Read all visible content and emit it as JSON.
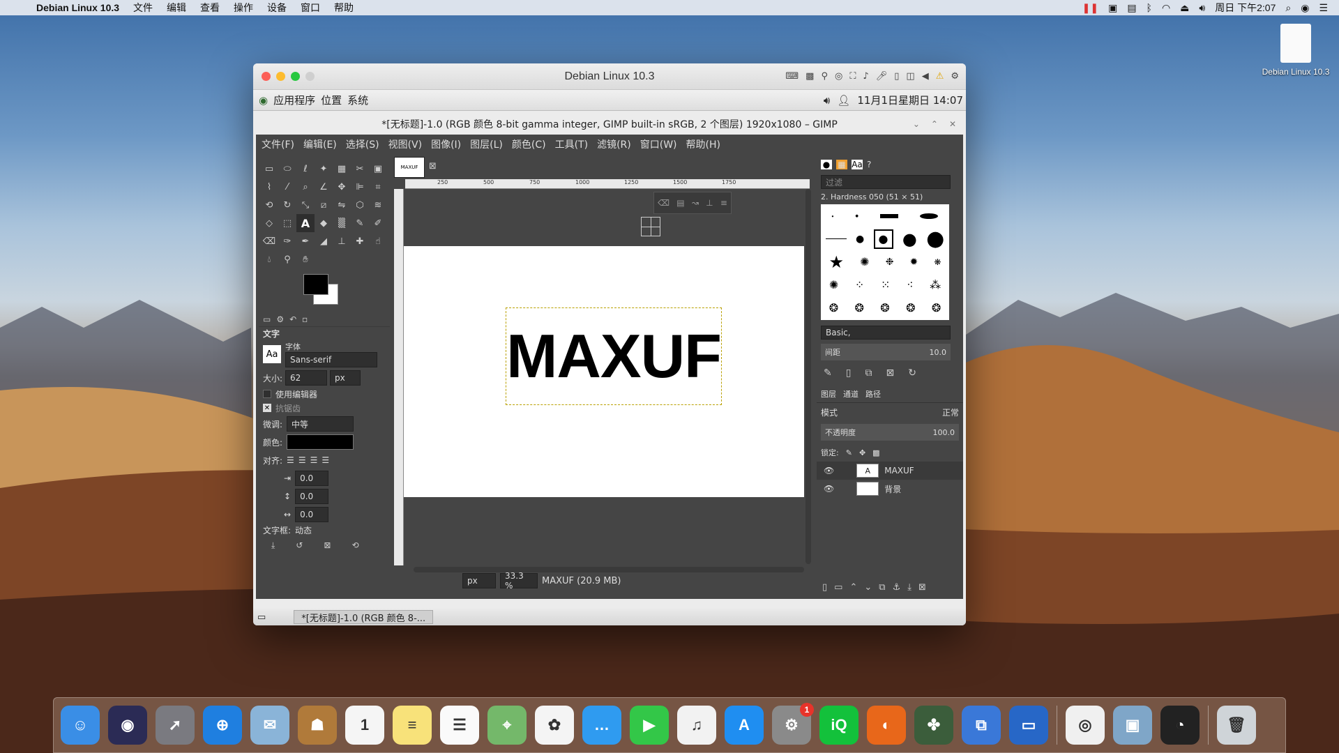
{
  "menubar": {
    "app": "Debian Linux 10.3",
    "items": [
      "文件",
      "编辑",
      "查看",
      "操作",
      "设备",
      "窗口",
      "帮助"
    ],
    "clock": "周日 下午2:07"
  },
  "desktop": {
    "file_label": "Debian Linux 10.3"
  },
  "vm": {
    "title": "Debian Linux 10.3",
    "panel_items": [
      "应用程序",
      "位置",
      "系统"
    ],
    "panel_clock": "11月1日星期日 14:07"
  },
  "gimp": {
    "title": "*[无标题]-1.0 (RGB 颜色 8-bit gamma integer, GIMP built-in sRGB, 2 个图层) 1920x1080 – GIMP",
    "menu": [
      "文件(F)",
      "编辑(E)",
      "选择(S)",
      "视图(V)",
      "图像(I)",
      "图层(L)",
      "颜色(C)",
      "工具(T)",
      "滤镜(R)",
      "窗口(W)",
      "帮助(H)"
    ],
    "image_tab": "MAXUF",
    "canvas_text": "MAXUF",
    "ruler_ticks": [
      "250",
      "500",
      "750",
      "1000",
      "1250",
      "1500",
      "1750"
    ],
    "unit": "px",
    "zoom": "33.3 %",
    "status": "MAXUF (20.9 MB)",
    "text_tool": {
      "header": "文字",
      "font_label": "字体",
      "font": "Sans-serif",
      "size_label": "大小:",
      "size": "62",
      "size_unit": "px",
      "use_editor": "使用编辑器",
      "antialias": "抗锯齿",
      "hinting_label": "微调:",
      "hinting": "中等",
      "color_label": "颜色:",
      "justify_label": "对齐:",
      "indent": "0.0",
      "line_spacing": "0.0",
      "letter_spacing": "0.0",
      "box_label": "文字框:",
      "box_value": "动态"
    },
    "brushes": {
      "filter_placeholder": "过滤",
      "current": "2. Hardness 050 (51 × 51)",
      "preset": "Basic,",
      "spacing_label": "间距",
      "spacing": "10.0"
    },
    "layers": {
      "tabs": [
        "图层",
        "通道",
        "路径"
      ],
      "mode_label": "模式",
      "mode": "正常",
      "opacity_label": "不透明度",
      "opacity": "100.0",
      "lock_label": "锁定:",
      "items": [
        {
          "name": "MAXUF",
          "thumb": "A"
        },
        {
          "name": "背景",
          "thumb": ""
        }
      ]
    }
  },
  "taskbar": {
    "item": "*[无标题]-1.0 (RGB 颜色 8-..."
  },
  "dock": {
    "apps": [
      {
        "name": "finder-icon",
        "color": "#3a8ee6",
        "glyph": "☺"
      },
      {
        "name": "siri-icon",
        "color": "#2b2b55",
        "glyph": "◉"
      },
      {
        "name": "launchpad-icon",
        "color": "#7a7a80",
        "glyph": "➚"
      },
      {
        "name": "safari-icon",
        "color": "#1f7fe0",
        "glyph": "⊕"
      },
      {
        "name": "mail-icon",
        "color": "#8ab4d8",
        "glyph": "✉"
      },
      {
        "name": "contacts-icon",
        "color": "#b07a3a",
        "glyph": "☗"
      },
      {
        "name": "calendar-icon",
        "color": "#f5f5f5",
        "glyph": "1"
      },
      {
        "name": "notes-icon",
        "color": "#f8e27a",
        "glyph": "≡"
      },
      {
        "name": "reminders-icon",
        "color": "#fafafa",
        "glyph": "☰"
      },
      {
        "name": "maps-icon",
        "color": "#74b86a",
        "glyph": "⌖"
      },
      {
        "name": "photos-icon",
        "color": "#f4f4f4",
        "glyph": "✿"
      },
      {
        "name": "messages-icon",
        "color": "#2f9bf0",
        "glyph": "…"
      },
      {
        "name": "facetime-icon",
        "color": "#33c748",
        "glyph": "▶"
      },
      {
        "name": "music-icon",
        "color": "#f2f2f2",
        "glyph": "♫"
      },
      {
        "name": "appstore-icon",
        "color": "#1f8ef1",
        "glyph": "A"
      },
      {
        "name": "preferences-icon",
        "color": "#8a8a8a",
        "glyph": "⚙",
        "badge": "1"
      },
      {
        "name": "iqiyi-icon",
        "color": "#13c13b",
        "glyph": "iQ"
      },
      {
        "name": "firefox-icon",
        "color": "#e8671a",
        "glyph": "◐"
      },
      {
        "name": "clover-icon",
        "color": "#3b5d3b",
        "glyph": "✤"
      },
      {
        "name": "vm-fusion-icon",
        "color": "#3a78d8",
        "glyph": "⧉"
      },
      {
        "name": "parallels-icon",
        "color": "#2767c7",
        "glyph": "▭"
      },
      {
        "name": "chrome-icon",
        "color": "#f0f0f0",
        "glyph": "◎"
      },
      {
        "name": "preview-icon",
        "color": "#7fa6c8",
        "glyph": "▣"
      },
      {
        "name": "recorder-icon",
        "color": "#222",
        "glyph": "◔"
      },
      {
        "name": "trash-icon",
        "color": "#cfd4d8",
        "glyph": "🗑"
      }
    ]
  }
}
